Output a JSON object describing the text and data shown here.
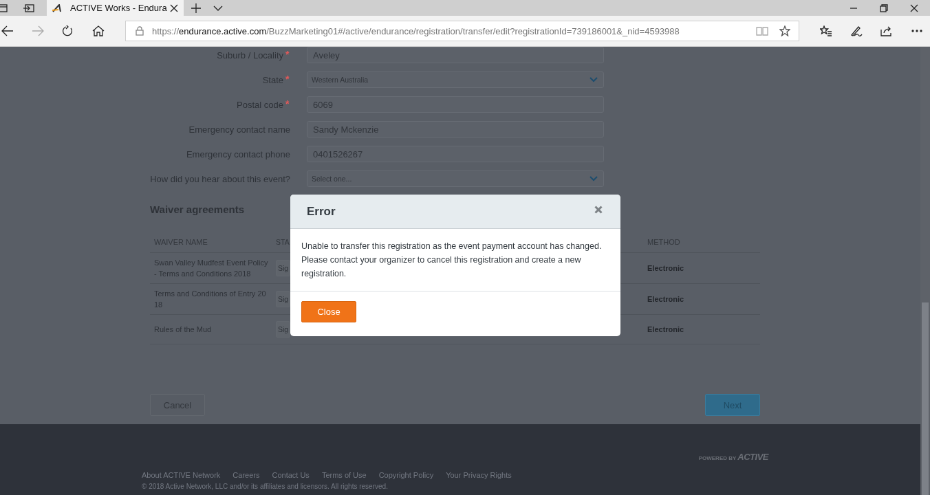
{
  "browser": {
    "tabs": [
      {
        "title": "ACTIVE Works - Endura",
        "selected": true
      }
    ],
    "nav_buttons": [
      {
        "kind": "back",
        "disabled": false
      },
      {
        "kind": "forward",
        "disabled": true
      },
      {
        "kind": "refresh",
        "disabled": false
      },
      {
        "kind": "home",
        "disabled": false
      }
    ],
    "address": {
      "scheme": "https://",
      "host": "endurance.active.com",
      "path": "/BuzzMarketing01#/active/endurance/registration/transfer/edit?registrationId=739186001&_nid=4593988"
    }
  },
  "form": {
    "fields": [
      {
        "label": "Suburb / Locality",
        "required_marker": "*",
        "kind": "text",
        "value": "Aveley"
      },
      {
        "label": "State",
        "required_marker": "*",
        "kind": "select",
        "value": "Western Australia"
      },
      {
        "label": "Postal code",
        "required_marker": "*",
        "kind": "text",
        "value": "6069"
      },
      {
        "label": "Emergency contact name",
        "kind": "text",
        "value": "Sandy Mckenzie"
      },
      {
        "label": "Emergency contact phone",
        "kind": "text",
        "value": "0401526267"
      },
      {
        "label": "How did you hear about this event?",
        "kind": "select",
        "value": "Select one..."
      }
    ]
  },
  "waivers": {
    "heading": "Waiver agreements",
    "columns": [
      "WAIVER NAME",
      "STA",
      "METHOD"
    ],
    "rows": [
      {
        "name": "Swan Valley Mudfest Event Policy - Terms and Conditions 2018",
        "status": "Sig",
        "method": "Electronic"
      },
      {
        "name": "Terms and Conditions of Entry 2018",
        "status": "Sig",
        "method": "Electronic"
      },
      {
        "name": "Rules of the Mud",
        "status": "Sig",
        "method": "Electronic"
      }
    ]
  },
  "actions": {
    "cancel": "Cancel",
    "next": "Next"
  },
  "footer": {
    "powered_by": "POWERED BY",
    "brand": "ACTIVE",
    "links": [
      "About ACTIVE Network",
      "Careers",
      "Contact Us",
      "Terms of Use",
      "Copyright Policy",
      "Your Privacy Rights"
    ],
    "copyright": "© 2018 Active Network, LLC and/or its affiliates and licensors. All rights reserved."
  },
  "modal": {
    "title": "Error",
    "message": "Unable to transfer this registration as the event payment account has changed. Please contact your organizer to cancel this registration and create a new registration.",
    "button": "Close"
  }
}
